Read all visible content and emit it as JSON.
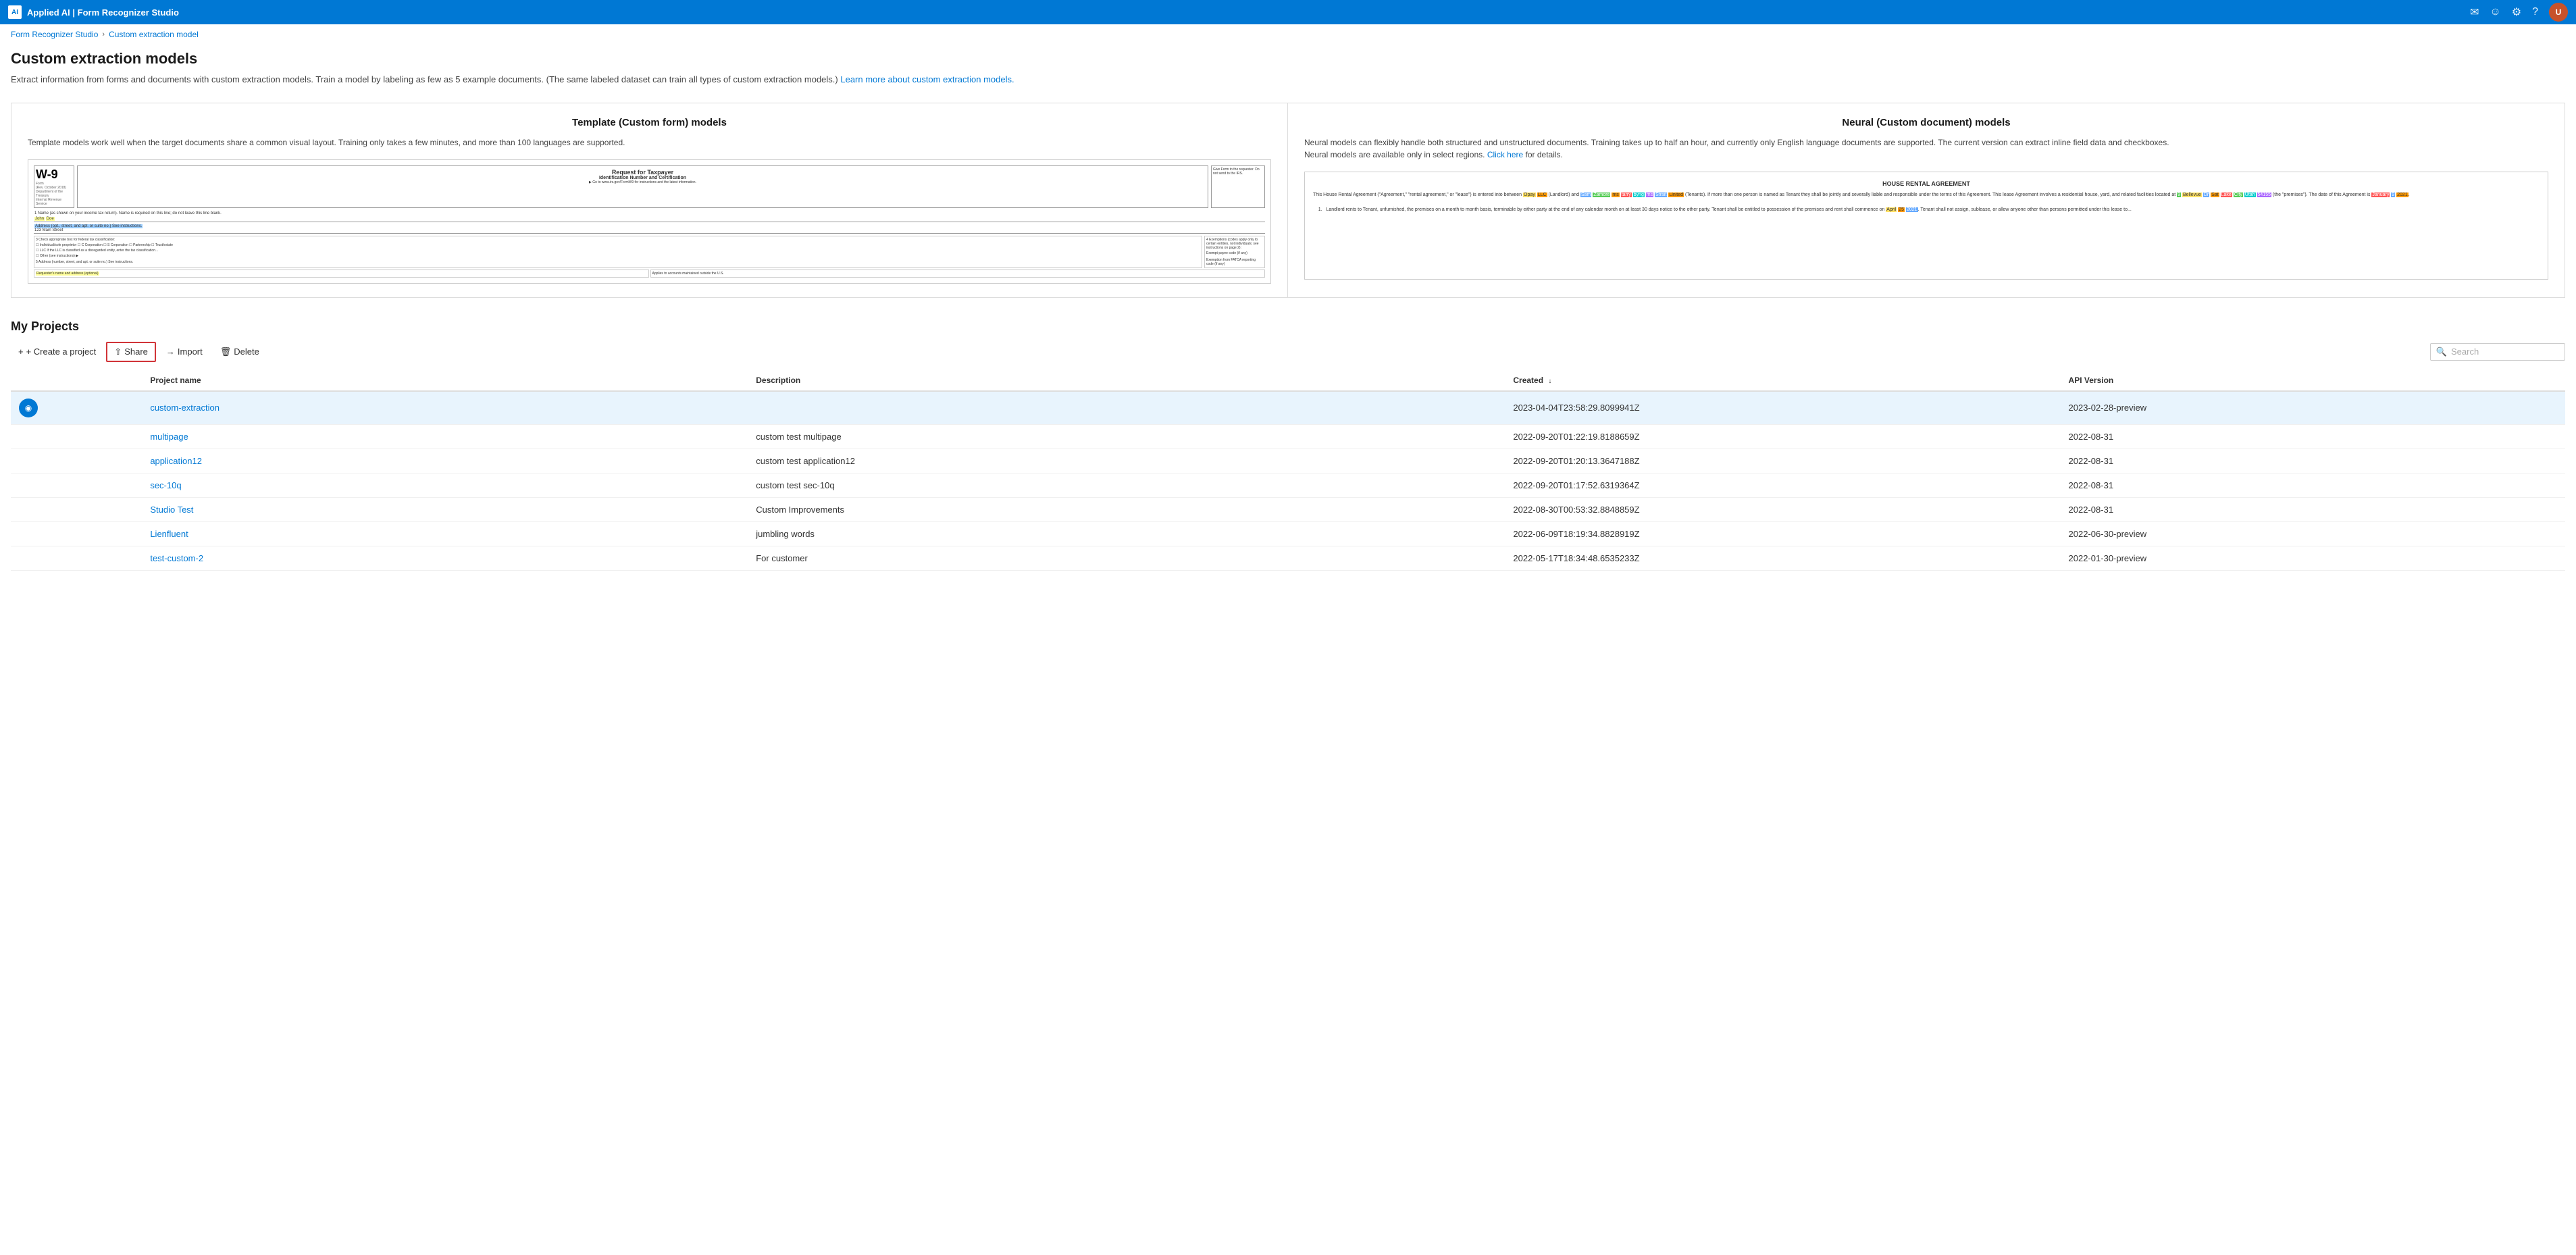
{
  "app": {
    "title": "Applied AI | Form Recognizer Studio",
    "logo_text": "AI"
  },
  "topbar": {
    "title": "Applied AI | Form Recognizer Studio",
    "icons": [
      "chat-icon",
      "smiley-icon",
      "settings-icon",
      "help-icon"
    ],
    "avatar_initials": "U"
  },
  "breadcrumb": {
    "items": [
      {
        "label": "Form Recognizer Studio",
        "href": "#"
      },
      {
        "label": "Custom extraction model",
        "href": "#"
      }
    ],
    "separator": "›"
  },
  "page": {
    "title": "Custom extraction models",
    "description": "Extract information from forms and documents with custom extraction models. Train a model by labeling as few as 5 example documents. (The same labeled dataset can train all types of custom extraction models.)",
    "learn_more_text": "Learn more about custom extraction models.",
    "learn_more_href": "#"
  },
  "model_cards": [
    {
      "id": "template",
      "title": "Template (Custom form) models",
      "description": "Template models work well when the target documents share a common visual layout. Training only takes a few minutes, and more than 100 languages are supported.",
      "link_text": "",
      "link_href": "#"
    },
    {
      "id": "neural",
      "title": "Neural (Custom document) models",
      "description": "Neural models can flexibly handle both structured and unstructured documents. Training takes up to half an hour, and currently only English language documents are supported. The current version can extract inline field data and checkboxes.",
      "description2": "Neural models are available only in select regions.",
      "link_text": "Click here",
      "link_href": "#",
      "link_suffix": "for details."
    }
  ],
  "projects": {
    "section_title": "My Projects",
    "toolbar": {
      "create_label": "+ Create a project",
      "share_label": "Share",
      "import_label": "Import",
      "delete_label": "Delete",
      "share_icon": "share-icon",
      "import_icon": "import-icon",
      "delete_icon": "delete-icon"
    },
    "search": {
      "placeholder": "Search"
    },
    "columns": [
      {
        "id": "name",
        "label": "Project name"
      },
      {
        "id": "description",
        "label": "Description"
      },
      {
        "id": "created",
        "label": "Created",
        "sortable": true,
        "sort_dir": "desc"
      },
      {
        "id": "api_version",
        "label": "API Version"
      }
    ],
    "rows": [
      {
        "id": "custom-extraction",
        "name": "custom-extraction",
        "description": "",
        "created": "2023-04-04T23:58:29.8099941Z",
        "api_version": "2023-02-28-preview",
        "selected": true,
        "has_icon": true
      },
      {
        "id": "multipage",
        "name": "multipage",
        "description": "custom test multipage",
        "created": "2022-09-20T01:22:19.8188659Z",
        "api_version": "2022-08-31",
        "selected": false,
        "has_icon": false
      },
      {
        "id": "application12",
        "name": "application12",
        "description": "custom test application12",
        "created": "2022-09-20T01:20:13.3647188Z",
        "api_version": "2022-08-31",
        "selected": false,
        "has_icon": false
      },
      {
        "id": "sec-10q",
        "name": "sec-10q",
        "description": "custom test sec-10q",
        "created": "2022-09-20T01:17:52.6319364Z",
        "api_version": "2022-08-31",
        "selected": false,
        "has_icon": false
      },
      {
        "id": "studio-test",
        "name": "Studio Test",
        "description": "Custom Improvements",
        "created": "2022-08-30T00:53:32.8848859Z",
        "api_version": "2022-08-31",
        "selected": false,
        "has_icon": false
      },
      {
        "id": "lienfluent",
        "name": "Lienfluent",
        "description": "jumbling words",
        "created": "2022-06-09T18:19:34.8828919Z",
        "api_version": "2022-06-30-preview",
        "selected": false,
        "has_icon": false
      },
      {
        "id": "test-custom-2",
        "name": "test-custom-2",
        "description": "For customer",
        "created": "2022-05-17T18:34:48.6535233Z",
        "api_version": "2022-01-30-preview",
        "selected": false,
        "has_icon": false
      }
    ]
  }
}
